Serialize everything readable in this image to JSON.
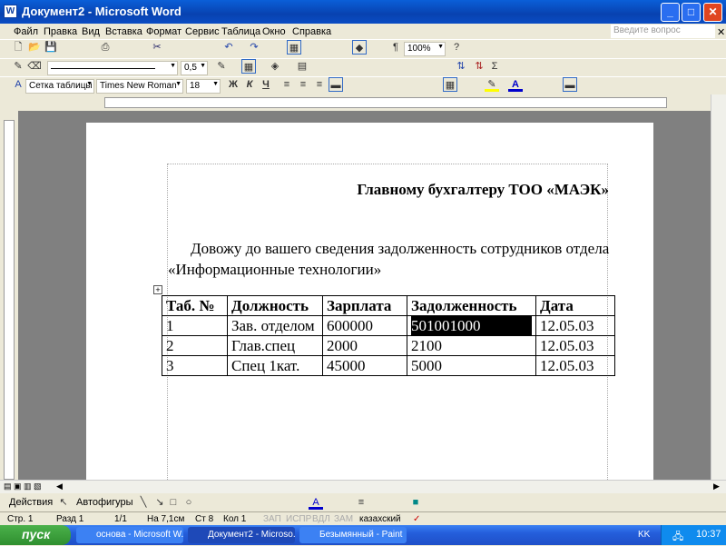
{
  "window": {
    "title": "Документ2 - Microsoft Word"
  },
  "menu": [
    "Файл",
    "Правка",
    "Вид",
    "Вставка",
    "Формат",
    "Сервис",
    "Таблица",
    "Окно",
    "Справка"
  ],
  "ask_placeholder": "Введите вопрос",
  "toolbar": {
    "zoom": "100%",
    "line_weight": "0,5",
    "style": "Сетка таблицы",
    "font": "Times New Roman",
    "size": "18",
    "bold": "Ж",
    "italic": "К",
    "underline": "Ч",
    "sum": "Σ"
  },
  "document": {
    "address": "Главному бухгалтеру ТОО «МАЭК»",
    "paragraph": "Довожу до вашего сведения задолженность сотрудников отдела «Информационные технологии»",
    "table": {
      "headers": [
        "Таб. №",
        "Должность",
        "Зарплата",
        "Задолженность",
        "Дата"
      ],
      "rows": [
        [
          "1",
          "Зав. отделом",
          "600000",
          "501001000",
          "12.05.03"
        ],
        [
          "2",
          "Глав.спец",
          "2000",
          "2100",
          "12.05.03"
        ],
        [
          "3",
          "Спец 1кат.",
          "45000",
          "5000",
          "12.05.03"
        ]
      ]
    }
  },
  "drawing": {
    "actions": "Действия",
    "autoshapes": "Автофигуры"
  },
  "status": {
    "page": "Стр. 1",
    "section": "Разд 1",
    "pages": "1/1",
    "at": "На 7,1см",
    "line": "Ст 8",
    "col": "Кол 1",
    "rec": "ЗАП",
    "trk": "ИСПР",
    "ext": "ВДЛ",
    "ovr": "ЗАМ",
    "lang": "казахский"
  },
  "taskbar": {
    "start": "пуск",
    "tasks": [
      "основа - Microsoft W...",
      "Документ2 - Microso...",
      "Безымянный - Paint"
    ],
    "lang": "KK",
    "clock": "10:37"
  }
}
